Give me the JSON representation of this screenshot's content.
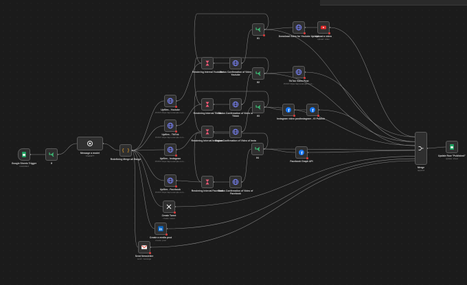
{
  "nodes": [
    {
      "id": "gsheets",
      "label": "Google Sheets Trigger",
      "sub": "rowAdded",
      "icon": "sheets-icon"
    },
    {
      "id": "if1",
      "label": "If",
      "sub": "",
      "icon": "if-icon"
    },
    {
      "id": "openai",
      "label": "Message a model",
      "sub": "ChatGPT",
      "icon": "openai-icon"
    },
    {
      "id": "merge_data",
      "label": "Redefining Merge all Range",
      "sub": "",
      "icon": "code-icon"
    },
    {
      "id": "up_yt",
      "label": "Upfiles - Youtube",
      "sub": "POST: https://api.example.com...",
      "icon": "http-icon"
    },
    {
      "id": "up_tt",
      "label": "Upfiles - TikTok",
      "sub": "POST: https://api.example.com...",
      "icon": "http-icon"
    },
    {
      "id": "up_ig",
      "label": "Upfiles - Instagram",
      "sub": "POST: https://api.example.com...",
      "icon": "http-icon"
    },
    {
      "id": "up_fb",
      "label": "Upfiles - Facebook",
      "sub": "POST: https://api.example.com...",
      "icon": "http-icon"
    },
    {
      "id": "wait_yt",
      "label": "Rendering Interval Youtube",
      "sub": "",
      "icon": "wait-icon"
    },
    {
      "id": "wait_tt",
      "label": "Rendering Interval Tiktok",
      "sub": "",
      "icon": "wait-icon"
    },
    {
      "id": "wait_ig",
      "label": "Rendering Interval Instagram",
      "sub": "",
      "icon": "wait-icon"
    },
    {
      "id": "wait_fb",
      "label": "Rendering Interval Facebook",
      "sub": "",
      "icon": "wait-icon"
    },
    {
      "id": "status_yt",
      "label": "Status Confirmation of Video Youtube",
      "sub": "",
      "icon": "http-icon"
    },
    {
      "id": "status_tt",
      "label": "Status Confirmation of Video of Tiktok",
      "sub": "",
      "icon": "http-icon"
    },
    {
      "id": "status_ig",
      "label": "Status Confirmation of Video of Insta",
      "sub": "",
      "icon": "http-icon"
    },
    {
      "id": "status_fb",
      "label": "Status Confirmation of Video of Facebook",
      "sub": "",
      "icon": "http-icon"
    },
    {
      "id": "if_yt",
      "label": "If1",
      "sub": "",
      "icon": "if-icon"
    },
    {
      "id": "if_tt",
      "label": "If2",
      "sub": "",
      "icon": "if-icon"
    },
    {
      "id": "if_ig",
      "label": "If3",
      "sub": "",
      "icon": "if-icon"
    },
    {
      "id": "if_fb",
      "label": "If4",
      "sub": "",
      "icon": "if-icon"
    },
    {
      "id": "dl_yt",
      "label": "Download Video for Youtube Upload",
      "sub": "",
      "icon": "http-icon"
    },
    {
      "id": "yt_upload",
      "label": "Upload a video",
      "sub": "upload: video",
      "icon": "youtube-icon"
    },
    {
      "id": "tt_post",
      "label": "TikTok Video Post",
      "sub": "POST: https://api.example.com...",
      "icon": "http-icon"
    },
    {
      "id": "ig_create",
      "label": "Instagram video post",
      "sub": "",
      "icon": "facebook-icon"
    },
    {
      "id": "ig_publish",
      "label": "Instagram - IG Publish",
      "sub": "",
      "icon": "facebook-icon"
    },
    {
      "id": "fb_post",
      "label": "Facebook Graph API",
      "sub": "",
      "icon": "facebook-icon"
    },
    {
      "id": "x_post",
      "label": "Create Tweet",
      "sub": "create: tweet",
      "icon": "x-icon"
    },
    {
      "id": "li_post",
      "label": "Create a media post",
      "sub": "create: post",
      "icon": "linkedin-icon"
    },
    {
      "id": "gmail",
      "label": "Send Newsletter",
      "sub": "send: message",
      "icon": "gmail-icon"
    },
    {
      "id": "merge",
      "label": "Merge",
      "sub": "append",
      "icon": "merge-icon"
    },
    {
      "id": "update_sheet",
      "label": "Update Row \"Published\"",
      "sub": "update: sheet",
      "icon": "sheets-icon"
    }
  ],
  "colors": {
    "background": "#1b1b1b",
    "node_bg": "#2f2f2f",
    "node_border": "#5a5a5a",
    "edge": "#9a9a9a",
    "http": "#7b86ff",
    "wait": "#ff5b7a",
    "if": "#3fcf7f",
    "sheets": "#1fa463",
    "facebook": "#1877f2",
    "linkedin": "#0a66c2",
    "youtube": "#e02b2b",
    "gmail": "#ea4335",
    "code": "#f5a623"
  }
}
